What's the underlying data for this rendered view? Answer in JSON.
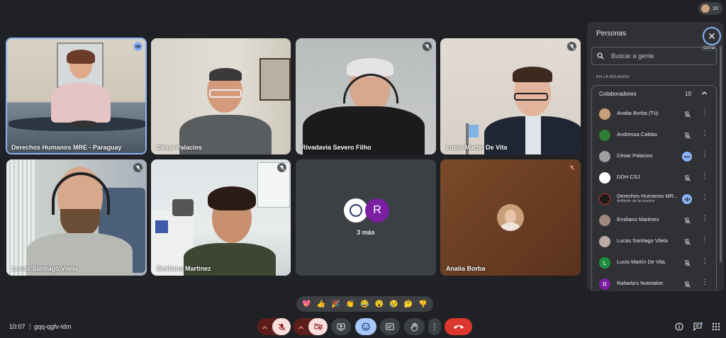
{
  "meeting": {
    "time": "10:07",
    "separator": "|",
    "code": "gqq-qgfv-ldm"
  },
  "top": {
    "participant_count": "10"
  },
  "tiles": [
    {
      "name": "Derechos Humanos MRE - Paraguay",
      "status": "speaking"
    },
    {
      "name": "César Palacios",
      "status": "none"
    },
    {
      "name": "Rivadavia Severo Filho",
      "status": "muted"
    },
    {
      "name": "Lucio Martín De Vita",
      "status": "muted"
    },
    {
      "name": "Lucas Santiago Vilela",
      "status": "muted"
    },
    {
      "name": "Emiliano Martinez",
      "status": "muted"
    },
    {
      "name": "",
      "status": "none",
      "more_label": "3 más",
      "avatar_letter": "R"
    },
    {
      "name": "Analia Borba",
      "status": "muted"
    }
  ],
  "panel": {
    "title": "Personas",
    "close_tooltip": "Cerrar",
    "search_placeholder": "Buscar a gente",
    "section_label": "EN LA REUNIÓN",
    "group_label": "Colaboradores",
    "group_count": "10",
    "participants": [
      {
        "name": "Analia Borba (Tú)",
        "sub": "",
        "letter": "",
        "color": "#c9a07a",
        "state": "muted"
      },
      {
        "name": "Andressa Caldas",
        "sub": "",
        "letter": "",
        "color": "#2e7d32",
        "state": "muted"
      },
      {
        "name": "César Palacios",
        "sub": "",
        "letter": "",
        "color": "#9e9e9e",
        "state": "more"
      },
      {
        "name": "DDH CSJ",
        "sub": "",
        "letter": "",
        "color": "#ffffff",
        "state": "muted"
      },
      {
        "name": "Derechos Humanos MR...",
        "sub": "Anfitrión de la reunión",
        "letter": "",
        "color": "#1a1a1a",
        "state": "speaking"
      },
      {
        "name": "Emiliano Martinez",
        "sub": "",
        "letter": "",
        "color": "#a1887f",
        "state": "muted"
      },
      {
        "name": "Lucas Santiago Vilela",
        "sub": "",
        "letter": "",
        "color": "#bcaaa4",
        "state": "muted"
      },
      {
        "name": "Lucio Martín De Vita",
        "sub": "",
        "letter": "L",
        "color": "#1e8e3e",
        "state": "muted"
      },
      {
        "name": "Rafaela's Notetaker",
        "sub": "",
        "letter": "R",
        "color": "#7b1fa2",
        "state": "muted"
      }
    ]
  },
  "reactions": [
    "💖",
    "👍",
    "🎉",
    "👏",
    "😂",
    "😮",
    "😢",
    "🤔",
    "👎"
  ],
  "controls": [
    "mic-off",
    "camera-off",
    "present",
    "emoji",
    "captions",
    "raise-hand",
    "more",
    "leave"
  ]
}
